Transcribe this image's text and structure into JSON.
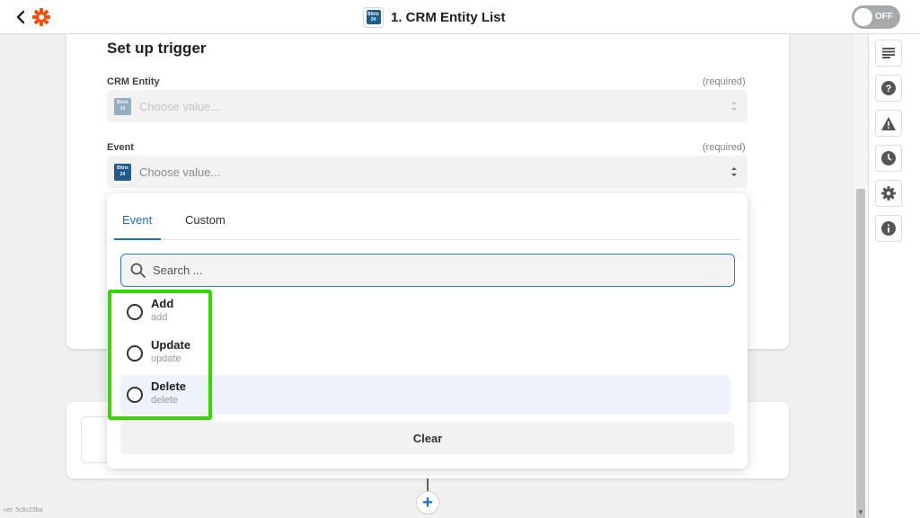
{
  "header": {
    "title": "1. CRM Entity List",
    "toggle_label": "OFF",
    "app_icon_text": "Bitrix 24",
    "brand_color": "#ff4a00"
  },
  "sidebar": {
    "icons": [
      "details-icon",
      "help-icon",
      "alert-icon",
      "history-icon",
      "settings-icon",
      "info-icon"
    ]
  },
  "setup": {
    "title": "Set up trigger",
    "fields": [
      {
        "label": "CRM Entity",
        "required": "(required)",
        "placeholder": "Choose value..."
      },
      {
        "label": "Event",
        "required": "(required)",
        "placeholder": "Choose value..."
      }
    ]
  },
  "dropdown": {
    "tabs": [
      {
        "label": "Event",
        "active": true
      },
      {
        "label": "Custom",
        "active": false
      }
    ],
    "search_placeholder": "Search ...",
    "options": [
      {
        "label": "Add",
        "value": "add"
      },
      {
        "label": "Update",
        "value": "update"
      },
      {
        "label": "Delete",
        "value": "delete"
      }
    ],
    "clear_label": "Clear"
  },
  "footer": {
    "version": "ver. 5c6c23ba"
  },
  "colors": {
    "accent": "#1a6ec9",
    "highlight": "#34d900"
  }
}
